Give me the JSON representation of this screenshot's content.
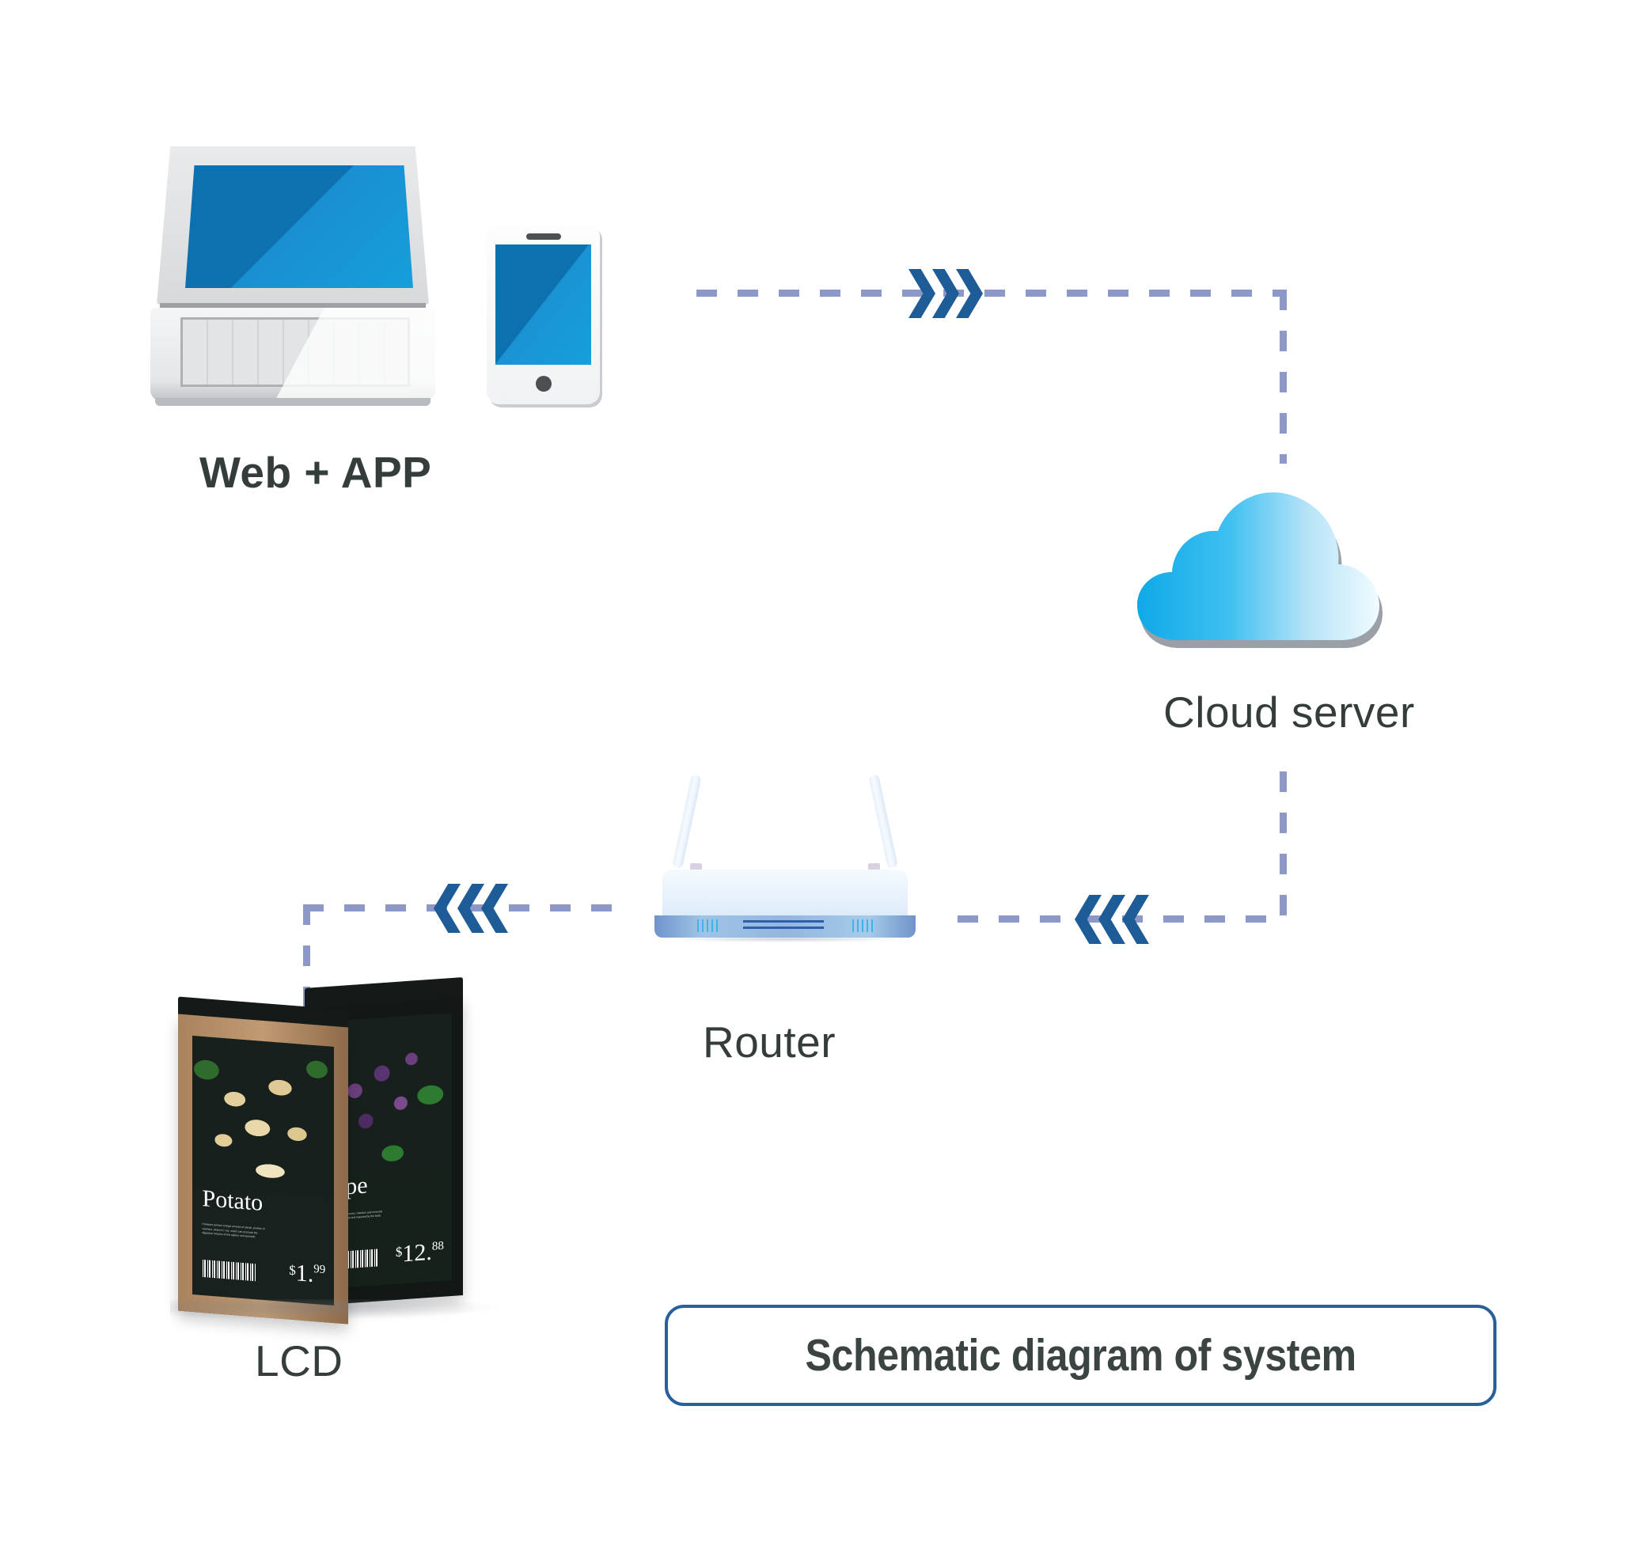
{
  "diagram": {
    "title": "Schematic diagram of system",
    "nodes": [
      {
        "id": "web-app",
        "label": "Web + APP",
        "icon": "laptop-and-phone-icon"
      },
      {
        "id": "cloud-server",
        "label": "Cloud server",
        "icon": "cloud-icon"
      },
      {
        "id": "router",
        "label": "Router",
        "icon": "router-icon"
      },
      {
        "id": "lcd",
        "label": "LCD",
        "icon": "lcd-display-icon"
      }
    ],
    "flows": [
      {
        "from": "web-app",
        "to": "cloud-server",
        "direction": "right",
        "chevrons": 3
      },
      {
        "from": "cloud-server",
        "to": "router",
        "direction": "left",
        "chevrons": 3
      },
      {
        "from": "router",
        "to": "lcd",
        "direction": "left",
        "chevrons": 3
      }
    ],
    "colors": {
      "dash_line": "#8c98c8",
      "chevron": "#1e5c97",
      "label_text": "#343d3c",
      "badge_border": "#2a6099",
      "cloud_blue": "#17a9e8",
      "screen_blue": "#0d71b0"
    }
  },
  "lcd_displays": [
    {
      "product": "Potato",
      "currency": "$",
      "price_whole": "1.",
      "price_cents": "99",
      "description": "Potatoes contain a large amount of starch, protein, B vitamins, vitamin C etc. which can promote the digestive function of the spleen and stomach.",
      "barcode": "barcode-icon"
    },
    {
      "product": "rape",
      "currency": "$",
      "price_whole": "12.",
      "price_cents": "88",
      "description": "Grapes contain glucose, vitamins and minerals which are beneficial and required by the body.",
      "barcode": "barcode-icon"
    }
  ]
}
